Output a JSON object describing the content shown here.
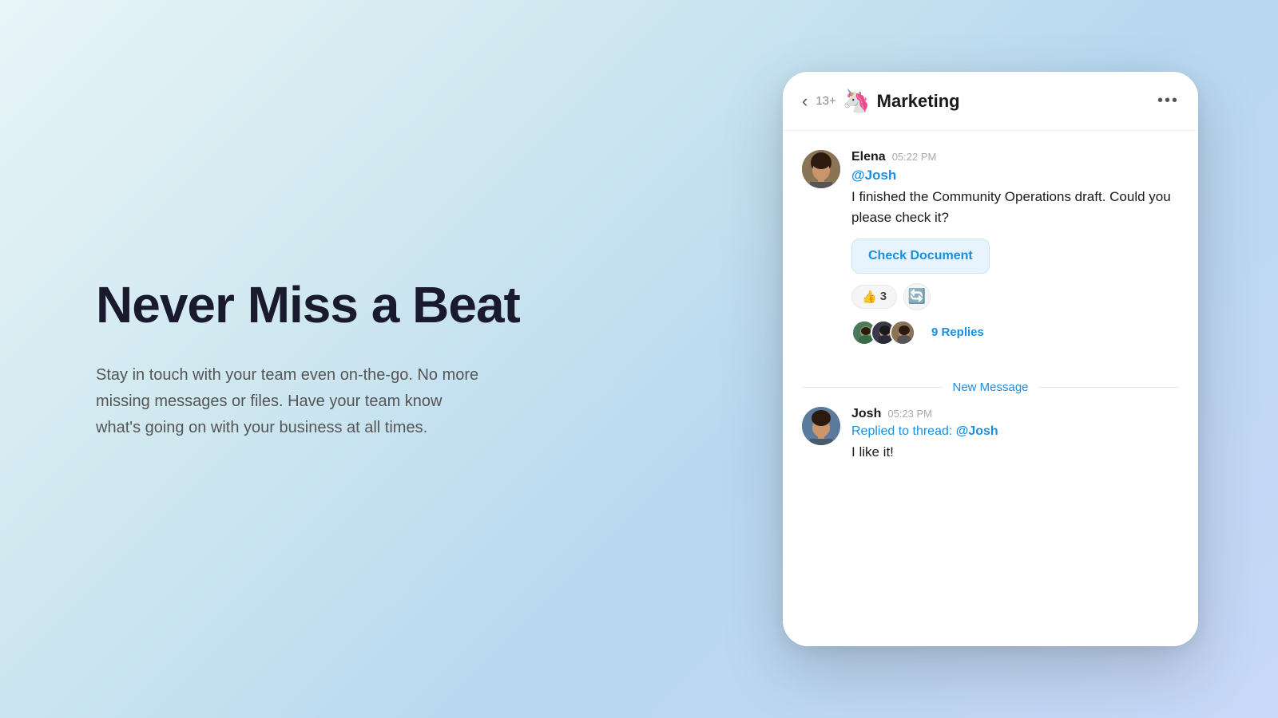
{
  "left": {
    "title": "Never Miss a Beat",
    "description": "Stay in touch with your team even on-the-go. No more missing messages or files. Have your team know what's going on with your business at all times."
  },
  "chat": {
    "header": {
      "back_label": "‹",
      "member_count": "13+",
      "channel_emoji": "🦄",
      "channel_name": "Marketing",
      "more_icon": "•••"
    },
    "messages": [
      {
        "id": "msg-elena",
        "sender": "Elena",
        "time": "05:22 PM",
        "mention": "@Josh",
        "text": "I finished the Community Operations draft. Could you please check it?",
        "button_label": "Check Document",
        "reaction_emoji": "👍",
        "reaction_count": "3",
        "replies_count": "9 Replies"
      },
      {
        "id": "msg-josh",
        "sender": "Josh",
        "time": "05:23 PM",
        "replied_prefix": "Replied to thread:",
        "replied_handle": "@Josh",
        "text": "I like it!"
      }
    ],
    "new_message_label": "New Message"
  }
}
